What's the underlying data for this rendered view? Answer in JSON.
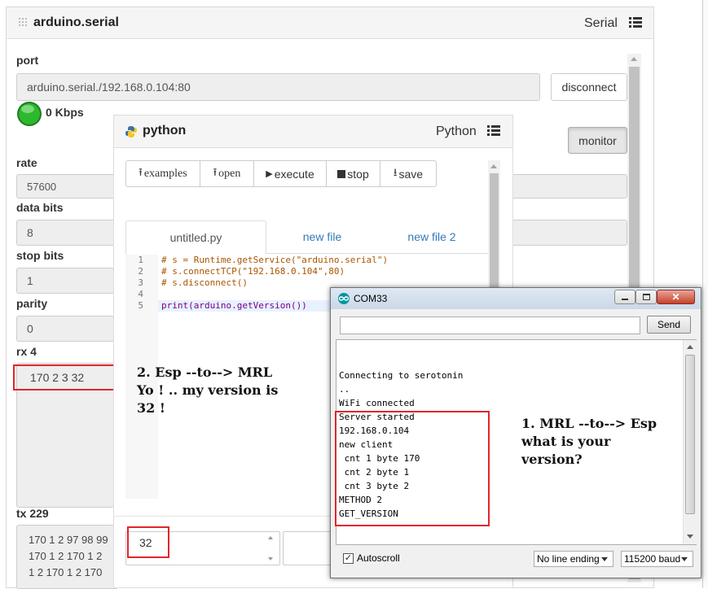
{
  "serial": {
    "title": "arduino.serial",
    "type_label": "Serial",
    "port_label": "port",
    "port_value": "arduino.serial./192.168.0.104:80",
    "disconnect_label": "disconnect",
    "rate_kbps": "0 Kbps",
    "monitor_label": "monitor",
    "rate_label": "rate",
    "rate_value": "57600",
    "data_bits_label": "data bits",
    "data_bits_value": "8",
    "stop_bits_label": "stop bits",
    "stop_bits_value": "1",
    "parity_label": "parity",
    "parity_value": "0",
    "rx_label": "rx 4",
    "rx_value": "170 2 3 32",
    "tx_label": "tx 229",
    "tx_lines": [
      "170 1 2 97 98 99",
      "170 1 2 170 1 2",
      "1 2 170 1 2 170"
    ]
  },
  "python": {
    "title": "python",
    "type_label": "Python",
    "toolbar": {
      "examples": "examples",
      "open": "open",
      "execute": "execute",
      "stop": "stop",
      "save": "save"
    },
    "tabs": [
      "untitled.py",
      "new file",
      "new file 2"
    ],
    "code_lines": [
      {
        "n": "1",
        "text": "# s = Runtime.getService(\"arduino.serial\")"
      },
      {
        "n": "2",
        "text": "# s.connectTCP(\"192.168.0.104\",80)"
      },
      {
        "n": "3",
        "text": "# s.disconnect()"
      },
      {
        "n": "4",
        "text": ""
      },
      {
        "n": "5",
        "text": "print(arduino.getVersion())"
      }
    ],
    "output_value": "32"
  },
  "annotations": {
    "esp_to_mrl": [
      "2. Esp --to--> MRL",
      "Yo ! .. my version is",
      "32 !"
    ],
    "mrl_to_esp": [
      "1. MRL --to--> Esp",
      "what is your",
      "version?"
    ]
  },
  "com": {
    "title": "COM33",
    "send_label": "Send",
    "lines": [
      "Connecting to serotonin",
      "..",
      "WiFi connected",
      "Server started",
      "192.168.0.104",
      "new client",
      " cnt 1 byte 170",
      " cnt 2 byte 1",
      " cnt 3 byte 2",
      "METHOD 2",
      "GET_VERSION"
    ],
    "autoscroll_label": "Autoscroll",
    "line_ending": "No line ending",
    "baud": "115200 baud"
  },
  "colors": {
    "accent_red": "#e0262b",
    "led_green": "#2db82d"
  }
}
